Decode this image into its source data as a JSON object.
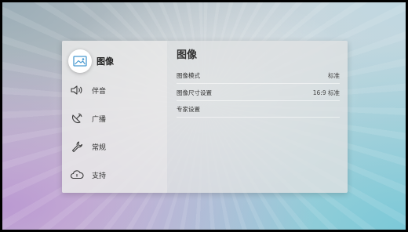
{
  "sidebar": {
    "items": [
      {
        "label": "图像",
        "icon": "picture-icon",
        "active": true
      },
      {
        "label": "伴音",
        "icon": "speaker-icon",
        "active": false
      },
      {
        "label": "广播",
        "icon": "satellite-dish-icon",
        "active": false
      },
      {
        "label": "常规",
        "icon": "wrench-icon",
        "active": false
      },
      {
        "label": "支持",
        "icon": "cloud-support-icon",
        "active": false
      }
    ]
  },
  "main": {
    "title": "图像",
    "settings": [
      {
        "label": "图像模式",
        "value": "标准"
      },
      {
        "label": "图像尺寸设置",
        "value": "16:9 标准"
      },
      {
        "label": "专家设置",
        "value": ""
      }
    ]
  },
  "colors": {
    "sidebar_bg": "#e8e8e8",
    "main_bg": "#dee0e2",
    "text": "#333333",
    "icon_stroke": "#3a3a3a",
    "icon_active": "#4a9bd1"
  }
}
